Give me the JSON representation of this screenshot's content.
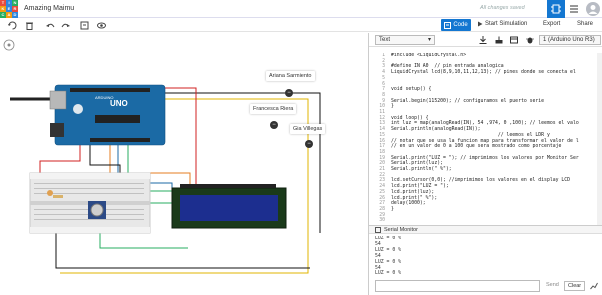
{
  "app": {
    "title": "Amazing Maimu",
    "status": "All changes saved",
    "logo_letters": [
      "T",
      "I",
      "N",
      "K",
      "E",
      "R",
      "C",
      "A",
      "D"
    ]
  },
  "toolbar": {
    "code_label": "Code",
    "start_sim_label": "Start Simulation",
    "export_label": "Export",
    "share_label": "Share"
  },
  "panel": {
    "mode": "Text",
    "device": "1 (Arduino Uno R3)",
    "line_numbers": "1\n2\n3\n4\n5\n6\n7\n8\n9\n10\n11\n12\n13\n14\n15\n16\n17\n18\n19\n20\n21\n22\n23\n24\n25\n26\n27\n28\n29\n30",
    "code": "#include <LiquidCrystal.h>\n\n#define IN A0  // pin entrada analogica\nLiquidCrystal lcd(8,9,10,11,12,13); // pines donde se conecta el\n\n\nvoid setup() {\n\nSerial.begin(115200); // configuramos el puerto serie\n}\n\nvoid loop() {\nint luz = map(analogRead(IN), 54 ,974, 0 ,100); // leemos el valo\nSerial.println(analogRead(IN));\n                                     // leemos el LDR y\n// notar que se usa la funcion map para transformar el valor de l\n// en un valor de 0 a 100 que sera mostrado como porcentaje\n\nSerial.print(\"LUZ = \"); // imprimimos los valores por Monitor Ser\nSerial.print(luz);\nSerial.println(\" %\");\n\nlcd.setCursor(0,0); //imprimimos los valores en el display LCD\nlcd.print(\"LUZ = \");\nlcd.print(luz);\nlcd.print(\" %\");\ndelay(1000);\n}\n\n",
    "serial_monitor_label": "Serial Monitor",
    "serial_output": "LUZ = 0 %\n54\nLUZ = 0 %\n54\nLUZ = 0 %\n54\nLUZ = 0 %",
    "send_label": "Send",
    "clear_label": "Clear"
  },
  "canvas": {
    "annotations": [
      "Ariana Sarmiento",
      "Francesca Riera",
      "Gia Villegas"
    ],
    "board_label": "UNO",
    "board_brand": "ARDUINO"
  },
  "colors": {
    "accent": "#1477d1",
    "board": "#1b6aa5",
    "lcd": "#1c2e8f"
  }
}
